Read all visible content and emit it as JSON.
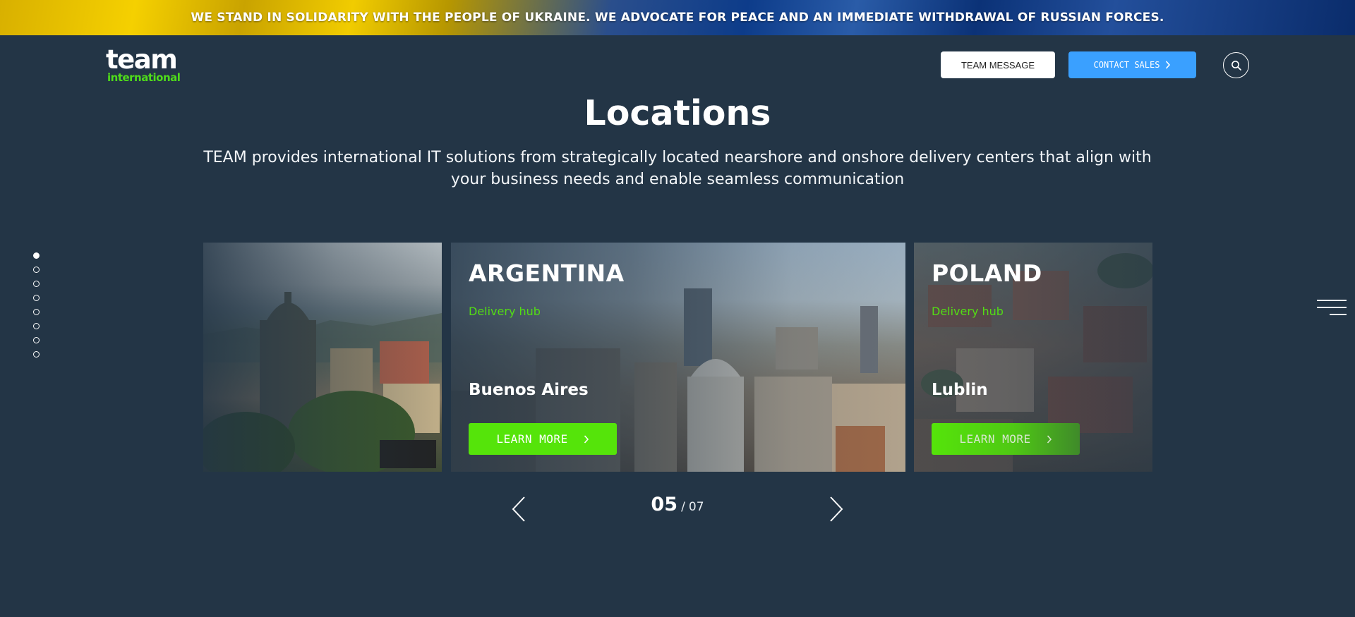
{
  "banner": {
    "text": "WE STAND IN SOLIDARITY WITH THE PEOPLE OF UKRAINE. WE ADVOCATE FOR PEACE AND AN IMMEDIATE WITHDRAWAL OF RUSSIAN FORCES."
  },
  "header": {
    "logo_top": "team",
    "logo_bottom": "international",
    "team_message_label": "TEAM MESSAGE",
    "contact_sales_label": "CONTACT SALES",
    "search_icon": "search-icon"
  },
  "main": {
    "title": "Locations",
    "subtitle": "TEAM provides international IT solutions from strategically located nearshore and onshore delivery centers that align with your business needs and enable seamless communication"
  },
  "side_nav": {
    "dots_count": 8,
    "active_index": 0
  },
  "cards": [
    {
      "country": "",
      "hub": "",
      "city": "",
      "button": ""
    },
    {
      "country": "ARGENTINA",
      "hub": "Delivery hub",
      "city": "Buenos Aires",
      "button": "LEARN MORE"
    },
    {
      "country": "POLAND",
      "hub": "Delivery hub",
      "city": "Lublin",
      "button": "LEARN MORE"
    }
  ],
  "pager": {
    "current": "05",
    "separator": "/",
    "total": "07"
  },
  "colors": {
    "background": "#233546",
    "accent_green": "#55e40a",
    "hub_green": "#53dd14",
    "contact_blue": "#3aa0ff"
  }
}
